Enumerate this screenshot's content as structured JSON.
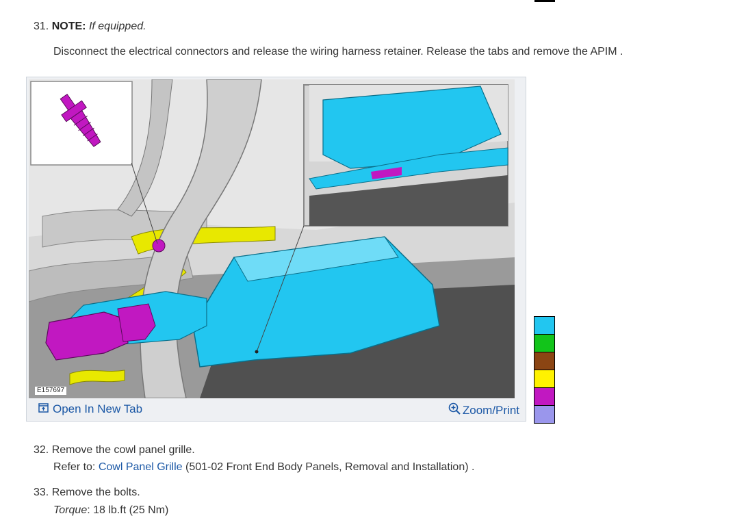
{
  "step31": {
    "number": "31.",
    "note_label": "NOTE:",
    "note_text": "If equipped.",
    "instruction": "Disconnect the electrical connectors and release the wiring harness retainer. Release the tabs and remove the APIM ."
  },
  "figure": {
    "id_label": "E157697",
    "open_tab_label": "Open In New Tab",
    "zoom_label": "Zoom/Print",
    "open_tab_icon": "open-in-new-tab-icon",
    "zoom_icon": "magnifier-plus-icon"
  },
  "legend": {
    "colors": [
      "#22c6f0",
      "#12c41a",
      "#8b4513",
      "#fff200",
      "#c118c1",
      "#9a96ec"
    ]
  },
  "step32": {
    "number": "32.",
    "text": "Remove the cowl panel grille.",
    "refer_prefix": "Refer to:",
    "refer_link": "Cowl Panel Grille",
    "refer_suffix": "(501-02 Front End Body Panels, Removal and Installation) ."
  },
  "step33": {
    "number": "33.",
    "text": "Remove the bolts.",
    "torque_label": "Torque",
    "torque_value": ": 18 lb.ft (25 Nm)"
  }
}
